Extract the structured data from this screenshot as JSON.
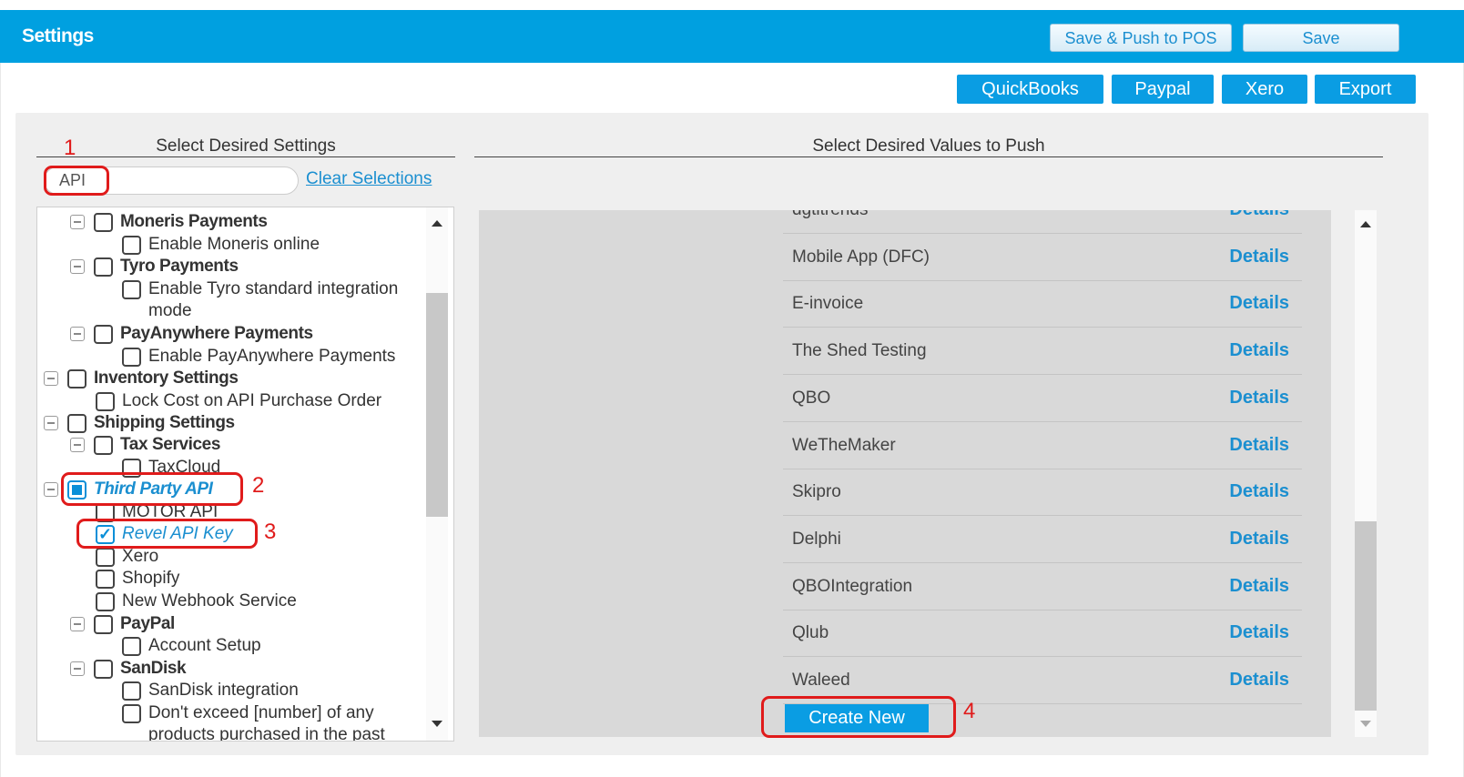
{
  "header": {
    "title": "Settings",
    "save_push_label": "Save & Push to POS",
    "save_label": "Save"
  },
  "integrations": [
    "QuickBooks",
    "Paypal",
    "Xero",
    "Export"
  ],
  "left": {
    "title": "Select Desired Settings",
    "search_value": "API",
    "clear_label": "Clear Selections",
    "tree": [
      {
        "label": "Moneris Payments",
        "bold": true,
        "collapse": true,
        "state": "unchecked"
      },
      {
        "label": "Enable Moneris online",
        "bold": false,
        "collapse": false,
        "state": "unchecked"
      },
      {
        "label": "Tyro Payments",
        "bold": true,
        "collapse": true,
        "state": "unchecked"
      },
      {
        "label": "Enable Tyro standard integration",
        "bold": false,
        "collapse": false,
        "state": "unchecked"
      },
      {
        "label": "mode",
        "bold": false,
        "collapse": false,
        "state": "none"
      },
      {
        "label": "PayAnywhere Payments",
        "bold": true,
        "collapse": true,
        "state": "unchecked"
      },
      {
        "label": "Enable PayAnywhere Payments",
        "bold": false,
        "collapse": false,
        "state": "unchecked"
      },
      {
        "label": "Inventory Settings",
        "bold": true,
        "collapse": true,
        "state": "unchecked"
      },
      {
        "label": "Lock Cost on API Purchase Order",
        "bold": false,
        "collapse": false,
        "state": "unchecked"
      },
      {
        "label": "Shipping Settings",
        "bold": true,
        "collapse": true,
        "state": "unchecked"
      },
      {
        "label": "Tax Services",
        "bold": true,
        "collapse": true,
        "state": "unchecked"
      },
      {
        "label": "TaxCloud",
        "bold": false,
        "collapse": false,
        "state": "unchecked"
      },
      {
        "label": "Third Party API",
        "bold": true,
        "collapse": true,
        "state": "partial"
      },
      {
        "label": "MOTOR API",
        "bold": false,
        "collapse": false,
        "state": "unchecked"
      },
      {
        "label": "Revel API Key",
        "bold": false,
        "collapse": false,
        "state": "checked"
      },
      {
        "label": "Xero",
        "bold": false,
        "collapse": false,
        "state": "unchecked"
      },
      {
        "label": "Shopify",
        "bold": false,
        "collapse": false,
        "state": "unchecked"
      },
      {
        "label": "New Webhook Service",
        "bold": false,
        "collapse": false,
        "state": "unchecked"
      },
      {
        "label": "PayPal",
        "bold": true,
        "collapse": true,
        "state": "unchecked"
      },
      {
        "label": "Account Setup",
        "bold": false,
        "collapse": false,
        "state": "unchecked"
      },
      {
        "label": "SanDisk",
        "bold": true,
        "collapse": true,
        "state": "unchecked"
      },
      {
        "label": "SanDisk integration",
        "bold": false,
        "collapse": false,
        "state": "unchecked"
      },
      {
        "label": "Don't exceed [number] of any",
        "bold": false,
        "collapse": false,
        "state": "unchecked"
      },
      {
        "label": "products purchased in the past",
        "bold": false,
        "collapse": false,
        "state": "none"
      }
    ]
  },
  "right": {
    "title": "Select Desired Values to Push",
    "details_label": "Details",
    "rows": [
      "dgtltrends",
      "Mobile App (DFC)",
      "E-invoice",
      "The Shed Testing",
      "QBO",
      "WeTheMaker",
      "Skipro",
      "Delphi",
      "QBOIntegration",
      "Qlub",
      "Waleed"
    ],
    "create_label": "Create New"
  },
  "annotations": [
    "1",
    "2",
    "3",
    "4"
  ],
  "colors": {
    "header_bg": "#00a0e0",
    "accent": "#0a9de3",
    "annotation": "#e01b1b"
  }
}
